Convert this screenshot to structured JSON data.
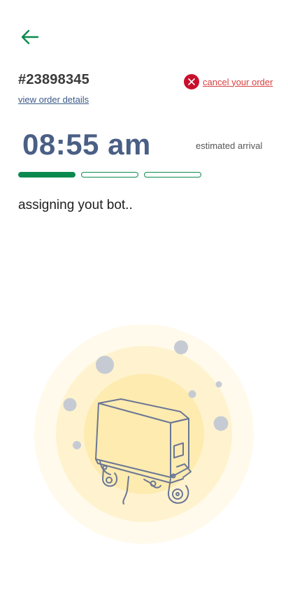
{
  "header": {
    "back_icon": "arrow-left-icon"
  },
  "order": {
    "id": "#23898345",
    "view_details_label": "view order details",
    "cancel_label": "cancel your order",
    "cancel_icon": "close-circle-icon"
  },
  "eta": {
    "time": "08:55 am",
    "label": "estimated arrival"
  },
  "progress": {
    "steps_total": 3,
    "steps_completed": 1
  },
  "status": {
    "message": "assigning yout bot.."
  },
  "illustration": {
    "icon": "delivery-robot-icon"
  },
  "colors": {
    "accent_green": "#0a8a4e",
    "time_blue": "#4a5f85",
    "cancel_red": "#c8102e",
    "link_blue": "#3c5a8a",
    "glow_yellow": "#fde9a8"
  }
}
